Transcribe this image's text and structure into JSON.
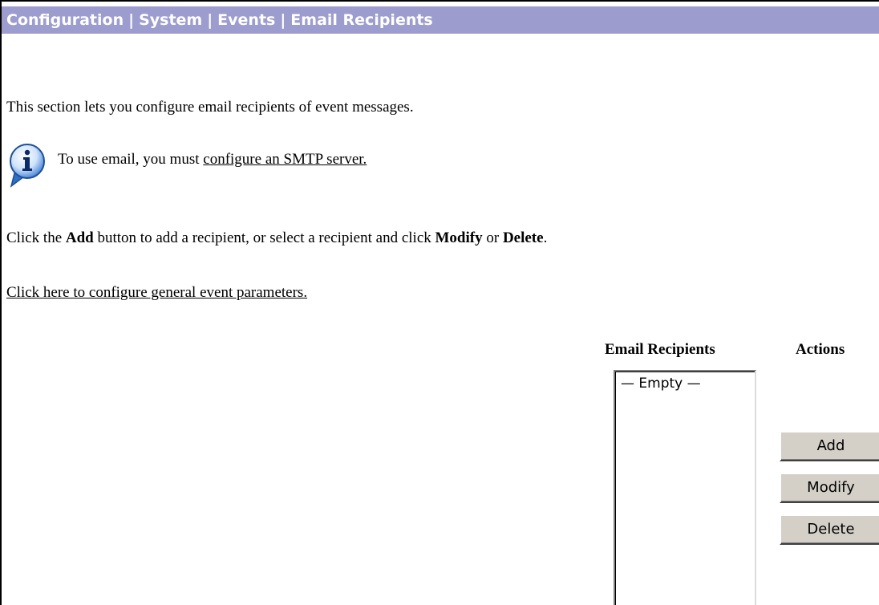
{
  "breadcrumb": {
    "items": [
      "Configuration",
      "System",
      "Events",
      "Email Recipients"
    ],
    "separator": "|"
  },
  "intro_text": "This section lets you configure email recipients of event messages.",
  "info": {
    "icon": "info-icon",
    "text": "To use email, you must ",
    "link_label": "configure an SMTP server."
  },
  "instructions": {
    "part1": "Click the ",
    "add": "Add",
    "part2": " button to add a recipient, or select a recipient and click ",
    "modify": "Modify",
    "part3": " or ",
    "delete": "Delete",
    "part4": "."
  },
  "general_link": "Click here to configure general event parameters.",
  "table": {
    "recipients_header": "Email Recipients",
    "actions_header": "Actions",
    "recipients": [
      "— Empty —"
    ]
  },
  "buttons": {
    "add": "Add",
    "modify": "Modify",
    "delete": "Delete"
  },
  "colors": {
    "header_bar": "#9c9ccf",
    "header_text": "#ffffff",
    "button_face": "#d4d0c8",
    "info_icon_blue": "#2f6fc4"
  }
}
